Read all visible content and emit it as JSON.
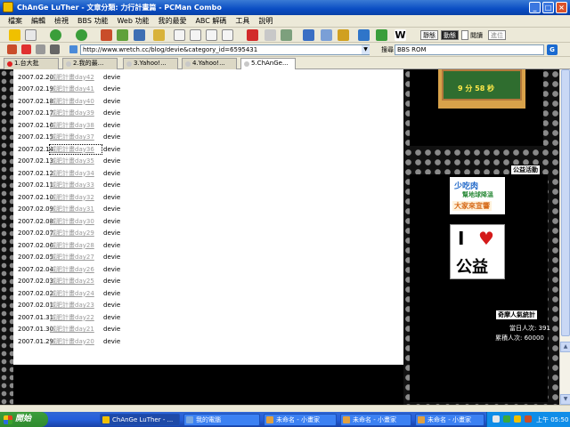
{
  "window": {
    "title": "ChAnGe LuTher - 文章分類: 力行計畫篇 - PCMan Combo"
  },
  "menu": [
    "檔案",
    "編輯",
    "檢視",
    "BBS 功能",
    "Web 功能",
    "我的最愛",
    "ABC 解碼",
    "工具",
    "說明"
  ],
  "toolbar": {
    "btn_b1": "靜態",
    "btn_b2": "動態",
    "checkbox_label": "閱讀",
    "btn_b3": "進位"
  },
  "address": {
    "url": "http://www.wretch.cc/blog/devie&category_id=6595431",
    "search_label": "搜尋：",
    "search_value": "BBS ROM"
  },
  "tabs": [
    {
      "label": "1.台大批"
    },
    {
      "label": "2.我的最..."
    },
    {
      "label": "3.Yahoo!..."
    },
    {
      "label": "4.Yahoo!..."
    },
    {
      "label": "5.ChAnGe..."
    }
  ],
  "archive": [
    {
      "date": "2007.02.20",
      "title": "減肥計畫day42",
      "author": "devie"
    },
    {
      "date": "2007.02.19",
      "title": "減肥計畫day41",
      "author": "devie"
    },
    {
      "date": "2007.02.18",
      "title": "減肥計畫day40",
      "author": "devie"
    },
    {
      "date": "2007.02.17",
      "title": "減肥計畫day39",
      "author": "devie"
    },
    {
      "date": "2007.02.16",
      "title": "減肥計畫day38",
      "author": "devie"
    },
    {
      "date": "2007.02.15",
      "title": "減肥計畫day37",
      "author": "devie"
    },
    {
      "date": "2007.02.14",
      "title": "減肥計畫day36",
      "author": "devie"
    },
    {
      "date": "2007.02.13",
      "title": "減肥計畫day35",
      "author": "devie"
    },
    {
      "date": "2007.02.12",
      "title": "減肥計畫day34",
      "author": "devie"
    },
    {
      "date": "2007.02.11",
      "title": "減肥計畫day33",
      "author": "devie"
    },
    {
      "date": "2007.02.10",
      "title": "減肥計畫day32",
      "author": "devie"
    },
    {
      "date": "2007.02.09",
      "title": "減肥計畫day31",
      "author": "devie"
    },
    {
      "date": "2007.02.08",
      "title": "減肥計畫day30",
      "author": "devie"
    },
    {
      "date": "2007.02.07",
      "title": "減肥計畫day29",
      "author": "devie"
    },
    {
      "date": "2007.02.06",
      "title": "減肥計畫day28",
      "author": "devie"
    },
    {
      "date": "2007.02.05",
      "title": "減肥計畫day27",
      "author": "devie"
    },
    {
      "date": "2007.02.04",
      "title": "減肥計畫day26",
      "author": "devie"
    },
    {
      "date": "2007.02.03",
      "title": "減肥計畫day25",
      "author": "devie"
    },
    {
      "date": "2007.02.02",
      "title": "減肥計畫day24",
      "author": "devie"
    },
    {
      "date": "2007.02.01",
      "title": "減肥計畫day23",
      "author": "devie"
    },
    {
      "date": "2007.01.31",
      "title": "減肥計畫day22",
      "author": "devie"
    },
    {
      "date": "2007.01.30",
      "title": "減肥計畫day21",
      "author": "devie"
    },
    {
      "date": "2007.01.29",
      "title": "減肥計畫day20",
      "author": "devie"
    }
  ],
  "sidebar": {
    "clock_text": "9 分 58 秒",
    "charity_title": "公益活動",
    "charity_banner": {
      "line1": "少吃肉",
      "line2": "幫地球降溫",
      "line3": "大家來宣響"
    },
    "love_banner": {
      "i": "I",
      "text": "公益"
    },
    "counter_title": "奇摩人氣統計",
    "today_visits": "當日人次: 391",
    "total_visits": "累積人次: 60000"
  },
  "taskbar": {
    "start_label": "開始",
    "tasks": [
      {
        "label": "ChAnGe LuTher - ..."
      },
      {
        "label": "我的電腦"
      },
      {
        "label": "未命名 - 小畫家"
      },
      {
        "label": "未命名 - 小畫家"
      },
      {
        "label": "未命名 - 小畫家"
      }
    ],
    "clock": "上午 05:50"
  },
  "colors": {
    "titlebar": "#0a4dc3",
    "link_gray": "#999999",
    "chalkboard": "#2f6d2f"
  }
}
